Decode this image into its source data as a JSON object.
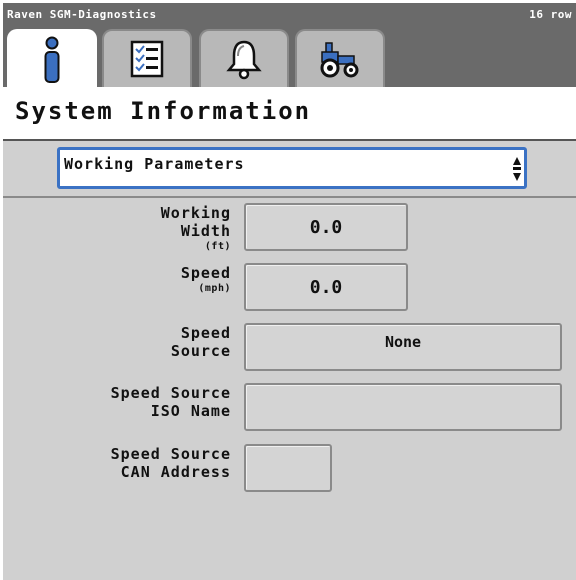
{
  "titlebar": {
    "app_title": "Raven SGM-Diagnostics",
    "row_count": "16 row"
  },
  "tabs": [
    {
      "icon": "info-icon",
      "active": true
    },
    {
      "icon": "checklist-icon",
      "active": false
    },
    {
      "icon": "alarm-bell-icon",
      "active": false
    },
    {
      "icon": "tractor-icon",
      "active": false
    }
  ],
  "page": {
    "title": "System Information"
  },
  "section_select": {
    "value": "Working Parameters"
  },
  "fields": {
    "working_width": {
      "label_line1": "Working",
      "label_line2": "Width",
      "unit": "(ft)",
      "value": "0.0"
    },
    "speed": {
      "label": "Speed",
      "unit": "(mph)",
      "value": "0.0"
    },
    "speed_source": {
      "label_line1": "Speed",
      "label_line2": "Source",
      "value": "None"
    },
    "speed_source_iso_name": {
      "label_line1": "Speed Source",
      "label_line2": "ISO Name",
      "value": ""
    },
    "speed_source_can_address": {
      "label_line1": "Speed Source",
      "label_line2": "CAN Address",
      "value": ""
    }
  },
  "colors": {
    "titlebar": "#6a6a6a",
    "select_border": "#3b72c4",
    "info_icon": "#3b6fc0",
    "panel": "#d0d0d0"
  }
}
